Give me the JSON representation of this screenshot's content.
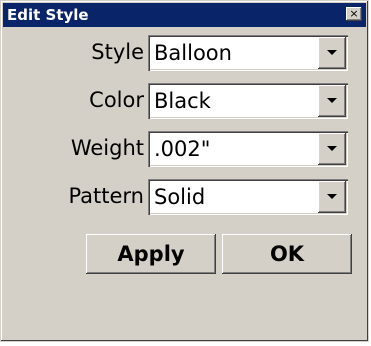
{
  "window": {
    "title": "Edit Style",
    "close_glyph": "×"
  },
  "fields": [
    {
      "label": "Style",
      "value": "Balloon"
    },
    {
      "label": "Color",
      "value": "Black"
    },
    {
      "label": "Weight",
      "value": ".002\""
    },
    {
      "label": "Pattern",
      "value": "Solid"
    }
  ],
  "buttons": {
    "apply_label": "Apply",
    "ok_label": "OK"
  },
  "colors": {
    "titlebar": "#0a246a",
    "window_bg": "#d4d0c8"
  },
  "icons": {
    "close": "close-icon",
    "dropdown": "chevron-down-icon"
  }
}
